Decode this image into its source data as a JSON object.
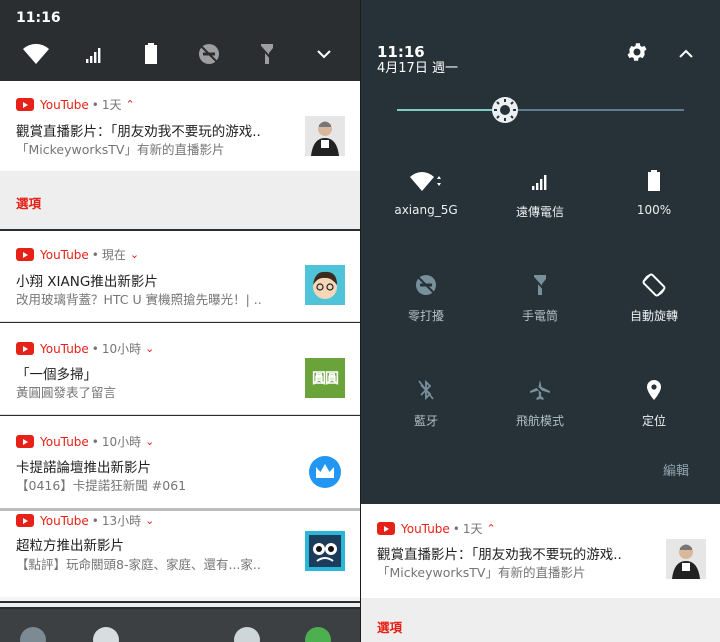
{
  "left": {
    "time": "11:16",
    "notifications": [
      {
        "app": "YouTube",
        "when": "1天",
        "chevron": "⌃",
        "title": "觀賞直播影片：「朋友劝我不要玩的游戏..",
        "sub": "「MickeyworksTV」有新的直播影片",
        "thumb": "person"
      },
      {
        "app": "YouTube",
        "when": "現在",
        "chevron": "⌄",
        "title": "小翔 XIANG推出新影片",
        "sub": "改用玻璃背蓋？HTC U 實機照搶先曝光！| ..",
        "thumb": "cartoon"
      },
      {
        "app": "YouTube",
        "when": "10小時",
        "chevron": "⌄",
        "title": "「一個多掃」",
        "sub": "黃圓圓發表了留言",
        "thumb": "green",
        "thumb_text": "圓圓"
      },
      {
        "app": "YouTube",
        "when": "10小時",
        "chevron": "⌄",
        "title": "卡提諾論壇推出新影片",
        "sub": "【0416】卡提諾狂新聞 #061",
        "thumb": "crown"
      },
      {
        "app": "YouTube",
        "when": "13小時",
        "chevron": "⌄",
        "title": "超粒方推出新影片",
        "sub": "【點評】玩命關頭8-家庭、家庭、還有...家..",
        "thumb": "superbig"
      }
    ],
    "options_label": "選項"
  },
  "right": {
    "time": "11:16",
    "date": "4月17日 週一",
    "brightness": 0.38,
    "tiles": [
      {
        "label": "axiang_5G",
        "icon": "wifi-icon"
      },
      {
        "label": "遠傳電信",
        "icon": "signal-icon"
      },
      {
        "label": "100%",
        "icon": "battery-icon"
      },
      {
        "label": "零打擾",
        "icon": "dnd-icon"
      },
      {
        "label": "手電筒",
        "icon": "flashlight-icon"
      },
      {
        "label": "自動旋轉",
        "icon": "rotate-icon"
      },
      {
        "label": "藍牙",
        "icon": "bluetooth-icon"
      },
      {
        "label": "飛航模式",
        "icon": "airplane-icon"
      },
      {
        "label": "定位",
        "icon": "location-icon"
      }
    ],
    "edit_label": "編輯",
    "notification": {
      "app": "YouTube",
      "when": "1天",
      "chevron": "⌃",
      "title": "觀賞直播影片：「朋友劝我不要玩的游戏..",
      "sub": "「MickeyworksTV」有新的直播影片"
    },
    "options_label": "選項"
  },
  "colors": {
    "accent": "#e62117",
    "slider": "#80cbc4",
    "qs_bg": "#263238"
  }
}
